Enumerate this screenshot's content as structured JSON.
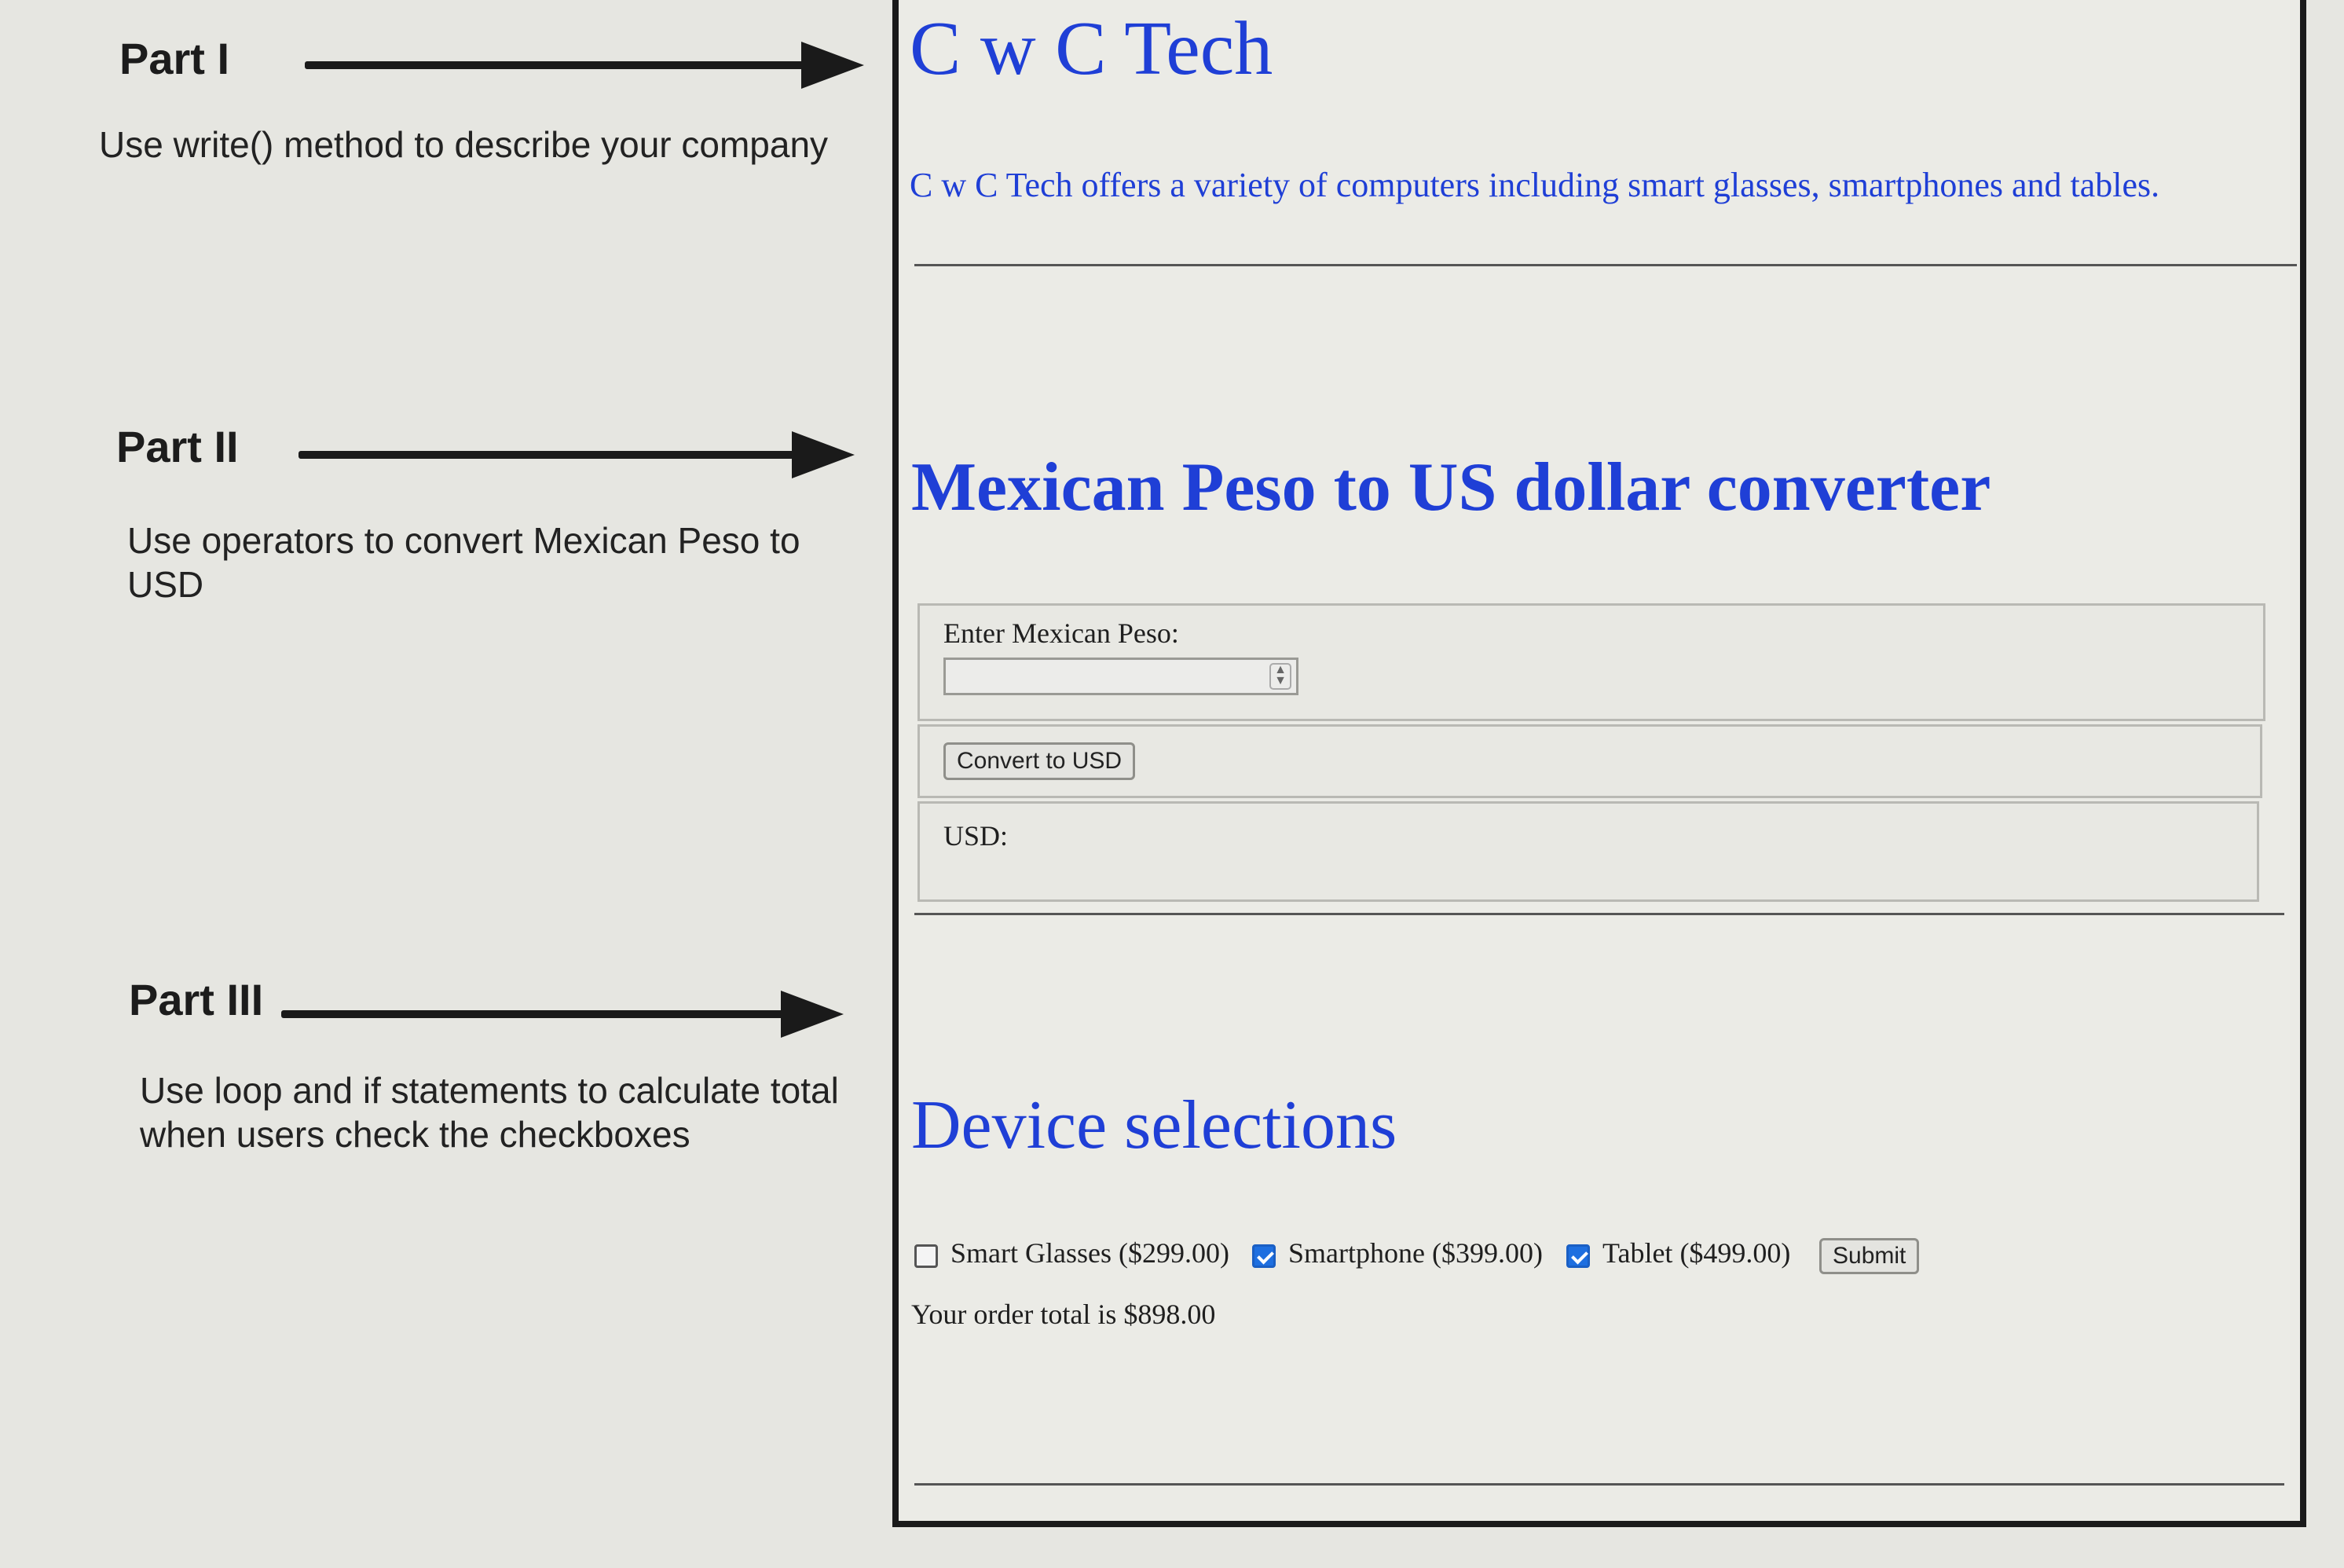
{
  "annotations": [
    {
      "title": "Part I",
      "description": "Use write() method to describe your company"
    },
    {
      "title": "Part II",
      "description": "Use operators to convert Mexican Peso to USD"
    },
    {
      "title": "Part III",
      "description": "Use loop and if statements to calculate total when users check the checkboxes"
    }
  ],
  "page": {
    "heading": "C w C Tech",
    "description": "C w C Tech offers a variety of computers including smart glasses, smartphones and tables.",
    "converter": {
      "heading": "Mexican Peso to US dollar converter",
      "input_label": "Enter Mexican Peso:",
      "input_value": "",
      "button_label": "Convert to USD",
      "result_label": "USD:"
    },
    "devices": {
      "heading": "Device selections",
      "items": [
        {
          "label": "Smart Glasses ($299.00)",
          "checked": false
        },
        {
          "label": "Smartphone ($399.00)",
          "checked": true
        },
        {
          "label": "Tablet ($499.00)",
          "checked": true
        }
      ],
      "submit_label": "Submit",
      "total_text": "Your order total is $898.00"
    }
  },
  "colors": {
    "heading_blue": "#1f3fd6",
    "checkbox_blue": "#1e6fe0"
  }
}
